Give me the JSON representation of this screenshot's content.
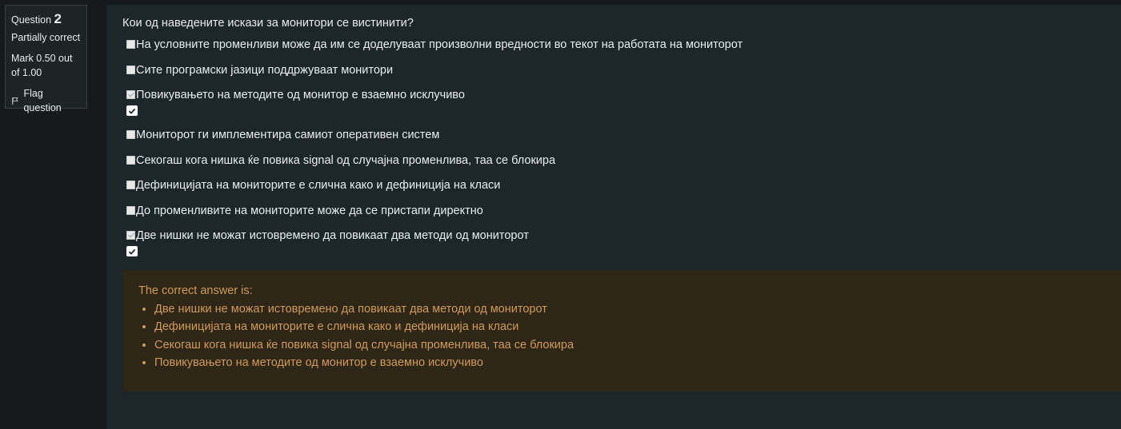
{
  "info": {
    "question_label": "Question",
    "question_number": "2",
    "state": "Partially correct",
    "grade": "Mark 0.50 out of 1.00",
    "flag_label": "Flag question"
  },
  "question": {
    "text": "Кои од наведените искази за монитори се вистинити?",
    "options": [
      {
        "label": "На условните променливи може да им се доделуваат произволни вредности во текот на работата на мониторот",
        "checked": false,
        "marked_correct": false
      },
      {
        "label": "Сите програмски јазици поддржуваат монитори",
        "checked": false,
        "marked_correct": false
      },
      {
        "label": "Повикувањето на методите од монитор е взаемно исклучиво",
        "checked": true,
        "marked_correct": true
      },
      {
        "label": "Мониторот ги имплементира самиот оперативен систем",
        "checked": false,
        "marked_correct": false
      },
      {
        "label": "Секогаш кога нишка ќе повика signal од случајна променлива, таа се блокира",
        "checked": false,
        "marked_correct": false
      },
      {
        "label": "Дефиницијата на мониторите е слична како и дефиниција на класи",
        "checked": false,
        "marked_correct": false
      },
      {
        "label": "До променливите на мониторите може да се пристапи директно",
        "checked": false,
        "marked_correct": false
      },
      {
        "label": "Две нишки не можат истовремено да повикаат два методи од мониторот",
        "checked": true,
        "marked_correct": true
      }
    ]
  },
  "feedback": {
    "heading": "The correct answer is:",
    "items": [
      "Две нишки не можат истовремено да повикаат два методи од мониторот",
      "Дефиницијата на мониторите е слична како и дефиниција на класи",
      "Секогаш кога нишка ќе повика signal од случајна променлива, таа се блокира",
      "Повикувањето на методите од монитор е взаемно исклучиво"
    ]
  },
  "colors": {
    "page_bg": "#171a1c",
    "content_bg": "#1d262a",
    "feedback_bg": "#2e2617",
    "feedback_text": "#cf9a5a"
  }
}
